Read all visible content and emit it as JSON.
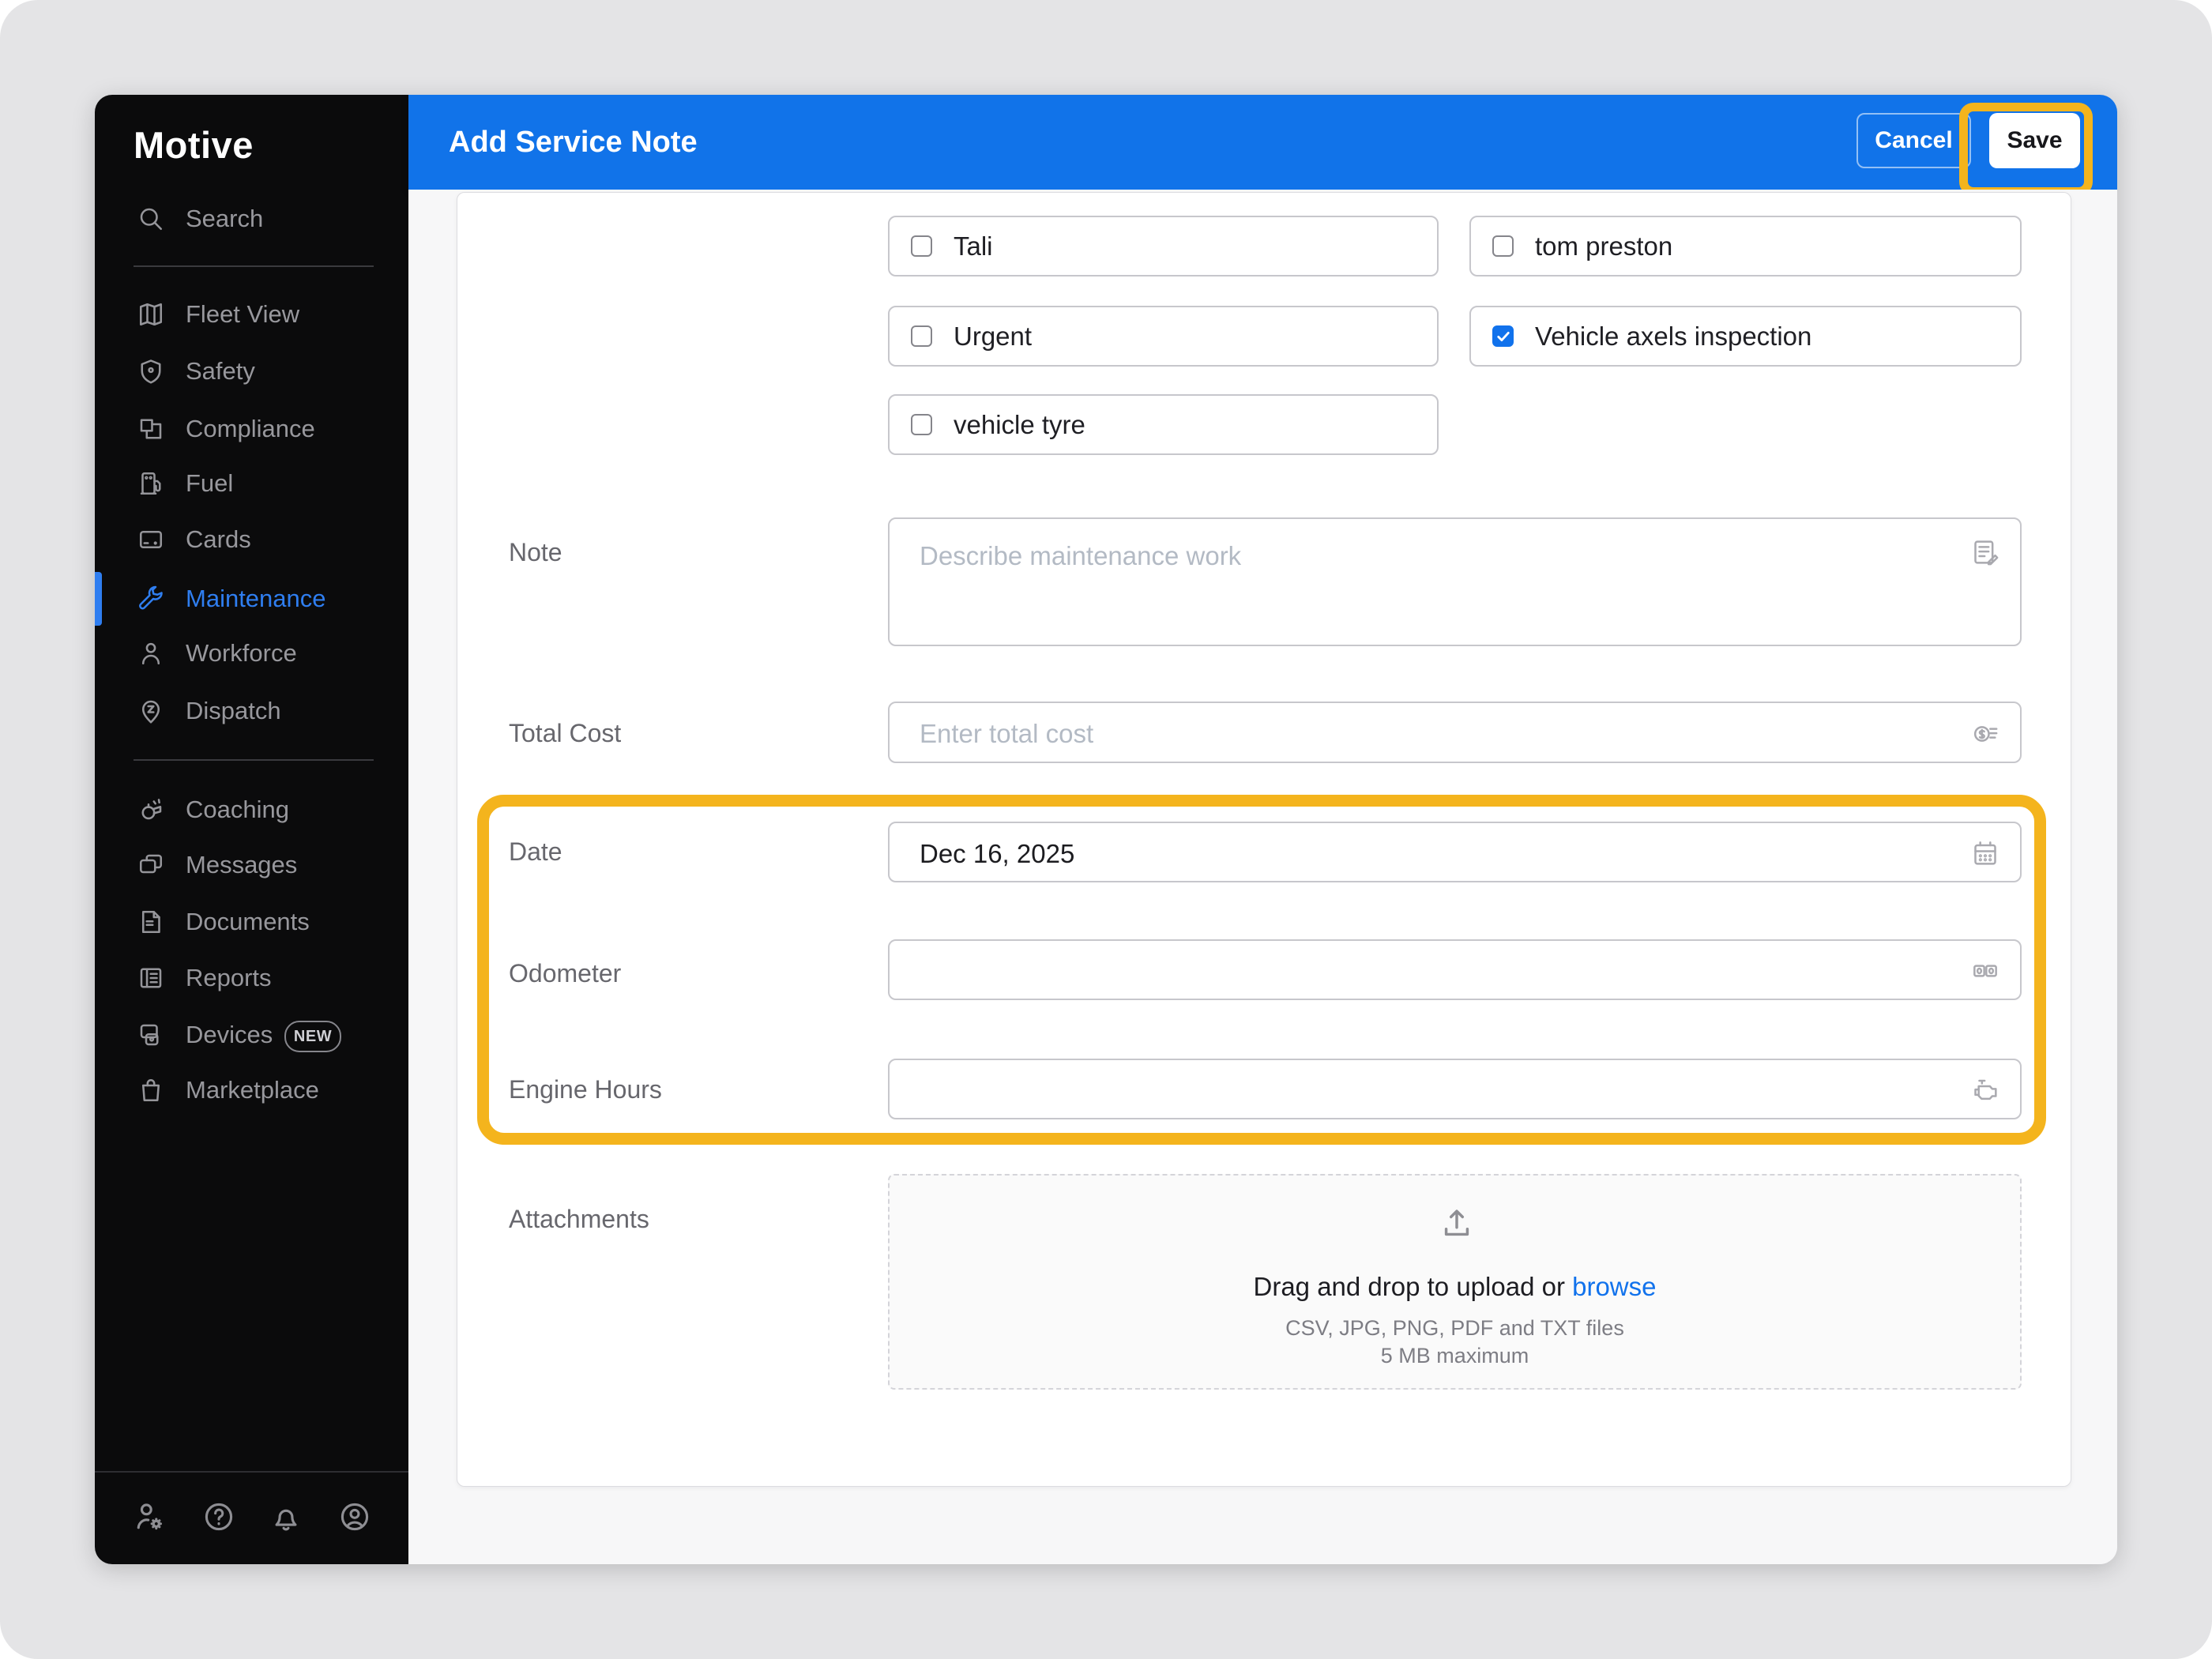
{
  "brand": {
    "logo": "Motive"
  },
  "header": {
    "title": "Add Service Note",
    "cancel_label": "Cancel",
    "save_label": "Save",
    "accent_color": "#1173e9",
    "highlight_color": "#f4b41d"
  },
  "sidebar": {
    "search_label": "Search",
    "items_primary": [
      {
        "label": "Fleet View"
      },
      {
        "label": "Safety"
      },
      {
        "label": "Compliance"
      },
      {
        "label": "Fuel"
      },
      {
        "label": "Cards"
      },
      {
        "label": "Maintenance",
        "active": true
      },
      {
        "label": "Workforce"
      },
      {
        "label": "Dispatch"
      }
    ],
    "items_secondary": [
      {
        "label": "Coaching"
      },
      {
        "label": "Messages"
      },
      {
        "label": "Documents"
      },
      {
        "label": "Reports"
      },
      {
        "label": "Devices",
        "badge": "NEW"
      },
      {
        "label": "Marketplace"
      }
    ],
    "devices_badge": "NEW"
  },
  "form": {
    "checkboxes": [
      {
        "label": "Tali",
        "checked": false
      },
      {
        "label": "Urgent",
        "checked": false
      },
      {
        "label": "vehicle tyre",
        "checked": false
      },
      {
        "label": "tom preston",
        "checked": false
      },
      {
        "label": "Vehicle axels inspection",
        "checked": true
      }
    ],
    "note": {
      "label": "Note",
      "placeholder": "Describe maintenance work"
    },
    "total_cost": {
      "label": "Total Cost",
      "placeholder": "Enter total cost"
    },
    "date": {
      "label": "Date",
      "value": "Dec 16, 2025"
    },
    "odometer": {
      "label": "Odometer",
      "value": ""
    },
    "engine_hours": {
      "label": "Engine Hours",
      "value": ""
    },
    "attachments": {
      "label": "Attachments",
      "drag_text": "Drag and drop to upload or ",
      "browse_label": "browse",
      "formats": "CSV, JPG, PNG, PDF and TXT files",
      "max_size": "5 MB maximum"
    }
  }
}
